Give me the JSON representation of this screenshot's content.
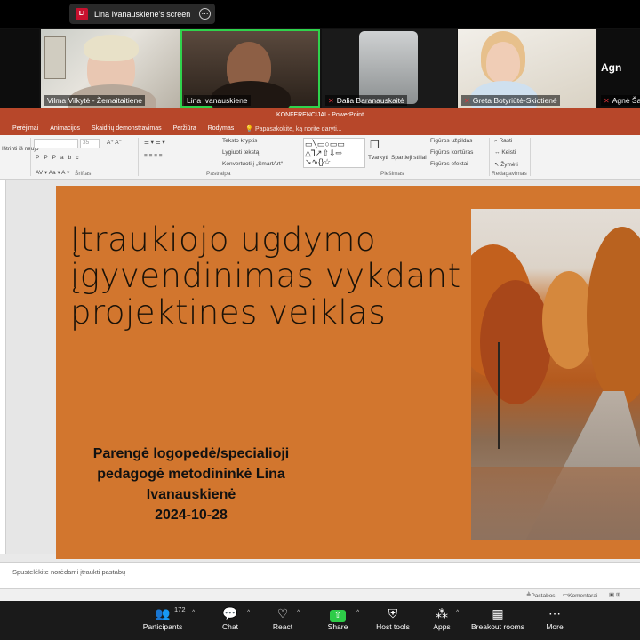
{
  "share_banner": {
    "initials": "LI",
    "text": "Lina Ivanauskiene's screen"
  },
  "participants": [
    {
      "name": "Vilma Vilkytė - Žemaitaitienė"
    },
    {
      "name": "Lina Ivanauskiene"
    },
    {
      "name": "Dalia Baranauskaitė"
    },
    {
      "name": "Greta Botyriūtė-Skiotienė"
    },
    {
      "name": "Agnė Ša",
      "initials": "Agn"
    }
  ],
  "powerpoint": {
    "window_title": "KONFERENCIJAI - PowerPoint",
    "tabs": [
      "Perėjimai",
      "Animacijos",
      "Skaidrių demonstravimas",
      "Peržiūra",
      "Rodymas",
      "Papasakokite, ką norite daryti..."
    ],
    "ribbon": {
      "left_items": [
        "Ištrinti iš naujo"
      ],
      "font_size": "35",
      "groups": [
        "Šriftas",
        "Pastraipa",
        "Piešimas",
        "Redagavimas"
      ],
      "paragraph_items": [
        "Teksto kryptis",
        "Lygiuoti tekstą",
        "Konvertuoti į „SmartArt“"
      ],
      "drawing_items": [
        "Tvarkyti",
        "Spartieji stiliai",
        "Figūros užpildas",
        "Figūros kontūras",
        "Figūros efektai"
      ],
      "editing_items": [
        "Rasti",
        "Keisti",
        "Žymėti"
      ]
    },
    "slide": {
      "title": "Įtraukiojo ugdymo įgyvendinimas vykdant projektines veiklas",
      "author_line1": "Parengė logopedė/specialioji",
      "author_line2": "pedagogė metodininkė Lina",
      "author_line3": "Ivanauskienė",
      "date": "2024-10-28"
    },
    "notes_placeholder": "Spustelėkite norėdami įtraukti pastabų",
    "status": {
      "notes": "Pastabos",
      "comments": "Komentarai"
    },
    "colors": {
      "slide_bg": "#d2762e",
      "ribbon_accent": "#b7472a"
    }
  },
  "toolbar": {
    "participants_label": "Participants",
    "participants_count": "172",
    "chat_label": "Chat",
    "react_label": "React",
    "share_label": "Share",
    "host_tools_label": "Host tools",
    "apps_label": "Apps",
    "breakout_label": "Breakout rooms",
    "more_label": "More"
  }
}
